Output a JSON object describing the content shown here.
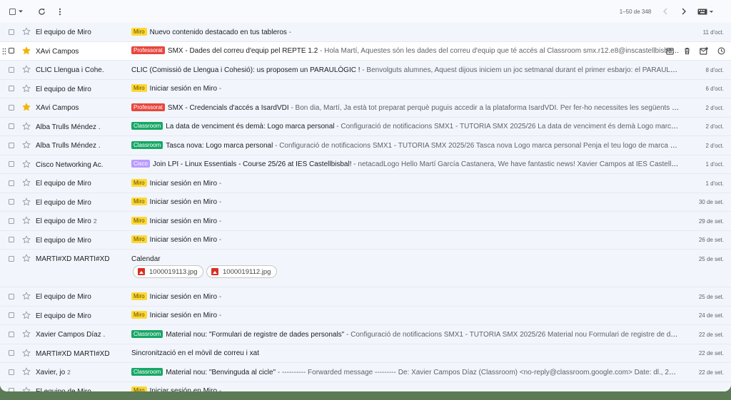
{
  "toolbar": {
    "select_icon": "checkbox-icon",
    "pager": "1–50 de 348"
  },
  "colors": {
    "miro": "#fdd835",
    "professorat": "#e8453c",
    "classroom": "#16a765",
    "cisco": "#b99aff",
    "star": "#f4b400"
  },
  "rows": [
    {
      "sender": "El equipo de Miro",
      "count": "",
      "label": "Miro",
      "label_type": "miro",
      "subject": "Nuevo contenido destacado en tus tableros",
      "snippet": " - ",
      "date": "11 d'oct.",
      "unread": false,
      "starred": false
    },
    {
      "sender": "XAvi Campos",
      "count": "",
      "label": "Professorat",
      "label_type": "professorat",
      "subject": "SMX - Dades del correu d'equip pel REPTE 1.2",
      "snippet": " - Hola Martí, Aquestes són les dades del correu d'equip que té accés al Classroom smx.r12.e8@inscastellbisbal....",
      "date": "",
      "unread": true,
      "starred": true,
      "hover": true
    },
    {
      "sender": "CLIC Llengua i Cohe.",
      "count": "",
      "label": "",
      "label_type": "",
      "subject": "CLIC (Comissió de Llengua i Cohesió): us proposem un PARAULÒGIC !",
      "snippet": " - Benvolguts alumnes, Aquest dijous iniciem un joc setmanal durant el primer esbarjo: el PARAULÒGIC !! Tots e...",
      "date": "8 d'oct.",
      "unread": false,
      "starred": false
    },
    {
      "sender": "El equipo de Miro",
      "count": "",
      "label": "Miro",
      "label_type": "miro",
      "subject": "Iniciar sesión en Miro",
      "snippet": " - ",
      "date": "6 d'oct.",
      "unread": false,
      "starred": false
    },
    {
      "sender": "XAvi Campos",
      "count": "",
      "label": "Professorat",
      "label_type": "professorat",
      "subject": "SMX - Credencials d'accés a IsardVDI",
      "snippet": " - Bon dia, Martí, Ja està tot preparat perquè puguis accedir a la plataforma IsardVDI. Per fer-ho necessites les següents dades: Us...",
      "date": "2 d'oct.",
      "unread": false,
      "starred": true
    },
    {
      "sender": "Alba Trulls Méndez .",
      "count": "",
      "label": "Classroom",
      "label_type": "classroom",
      "subject": "La data de venciment és demà: Logo marca personal",
      "snippet": " - Configuració de notificacions SMX1 - TUTORIA SMX 2025/26 La data de venciment és demà Logo marca personal ...",
      "date": "2 d'oct.",
      "unread": false,
      "starred": false
    },
    {
      "sender": "Alba Trulls Méndez .",
      "count": "",
      "label": "Classroom",
      "label_type": "classroom",
      "subject": "Tasca nova: Logo marca personal",
      "snippet": " - Configuració de notificacions SMX1 - TUTORIA SMX 2025/26 Tasca nova Logo marca personal Penja el teu logo de marca personal i el...",
      "date": "2 d'oct.",
      "unread": false,
      "starred": false
    },
    {
      "sender": "Cisco Networking Ac.",
      "count": "",
      "label": "Cisco",
      "label_type": "cisco",
      "subject": "Join LPI - Linux Essentials - Course 25/26 at IES Castellbisbal!",
      "snippet": " - netacadLogo Hello Martí García Castanera, We have fantastic news! Xavier Campos at IES Castellbisbal has pe...",
      "date": "1 d'oct.",
      "unread": false,
      "starred": false
    },
    {
      "sender": "El equipo de Miro",
      "count": "",
      "label": "Miro",
      "label_type": "miro",
      "subject": "Iniciar sesión en Miro",
      "snippet": " - ",
      "date": "1 d'oct.",
      "unread": false,
      "starred": false
    },
    {
      "sender": "El equipo de Miro",
      "count": "",
      "label": "Miro",
      "label_type": "miro",
      "subject": "Iniciar sesión en Miro",
      "snippet": " - ",
      "date": "30 de set.",
      "unread": false,
      "starred": false
    },
    {
      "sender": "El equipo de Miro",
      "count": "2",
      "label": "Miro",
      "label_type": "miro",
      "subject": "Iniciar sesión en Miro",
      "snippet": " - ",
      "date": "29 de set.",
      "unread": false,
      "starred": false
    },
    {
      "sender": "El equipo de Miro",
      "count": "",
      "label": "Miro",
      "label_type": "miro",
      "subject": "Iniciar sesión en Miro",
      "snippet": " - ",
      "date": "26 de set.",
      "unread": false,
      "starred": false
    },
    {
      "sender": "MARTÍ#XD MARTÍ#XD",
      "count": "",
      "label": "",
      "label_type": "",
      "subject": "Calendar",
      "snippet": "",
      "date": "25 de set.",
      "unread": false,
      "starred": false,
      "attachments": [
        "1000019113.jpg",
        "1000019112.jpg"
      ]
    },
    {
      "sender": "El equipo de Miro",
      "count": "",
      "label": "Miro",
      "label_type": "miro",
      "subject": "Iniciar sesión en Miro",
      "snippet": " - ",
      "date": "25 de set.",
      "unread": false,
      "starred": false
    },
    {
      "sender": "El equipo de Miro",
      "count": "",
      "label": "Miro",
      "label_type": "miro",
      "subject": "Iniciar sesión en Miro",
      "snippet": " - ",
      "date": "24 de set.",
      "unread": false,
      "starred": false
    },
    {
      "sender": "Xavier Campos Díaz .",
      "count": "",
      "label": "Classroom",
      "label_type": "classroom",
      "subject": "Material nou: \"Formulari de registre de dades personals\"",
      "snippet": " - Configuració de notificacions SMX1 - TUTORIA SMX 2025/26 Material nou Formulari de registre de dades perso...",
      "date": "22 de set.",
      "unread": false,
      "starred": false
    },
    {
      "sender": "MARTÍ#XD MARTÍ#XD",
      "count": "",
      "label": "",
      "label_type": "",
      "subject": "Sincronització en el mòvil de correu i xat",
      "snippet": "",
      "date": "22 de set.",
      "unread": false,
      "starred": false
    },
    {
      "sender": "Xavier, jo",
      "count": "2",
      "label": "Classroom",
      "label_type": "classroom",
      "subject": "Material nou: \"Benvinguda al cicle\"",
      "snippet": " - ---------- Forwarded message --------- De: Xavier Campos Díaz (Classroom) <no-reply@classroom.google.com> Date: dl., 22 de se...",
      "date": "22 de set.",
      "unread": false,
      "starred": false
    },
    {
      "sender": "El equipo de Miro",
      "count": "",
      "label": "Miro",
      "label_type": "miro",
      "subject": "Iniciar sesión en Miro",
      "snippet": " - ",
      "date": "",
      "unread": false,
      "starred": false
    }
  ]
}
